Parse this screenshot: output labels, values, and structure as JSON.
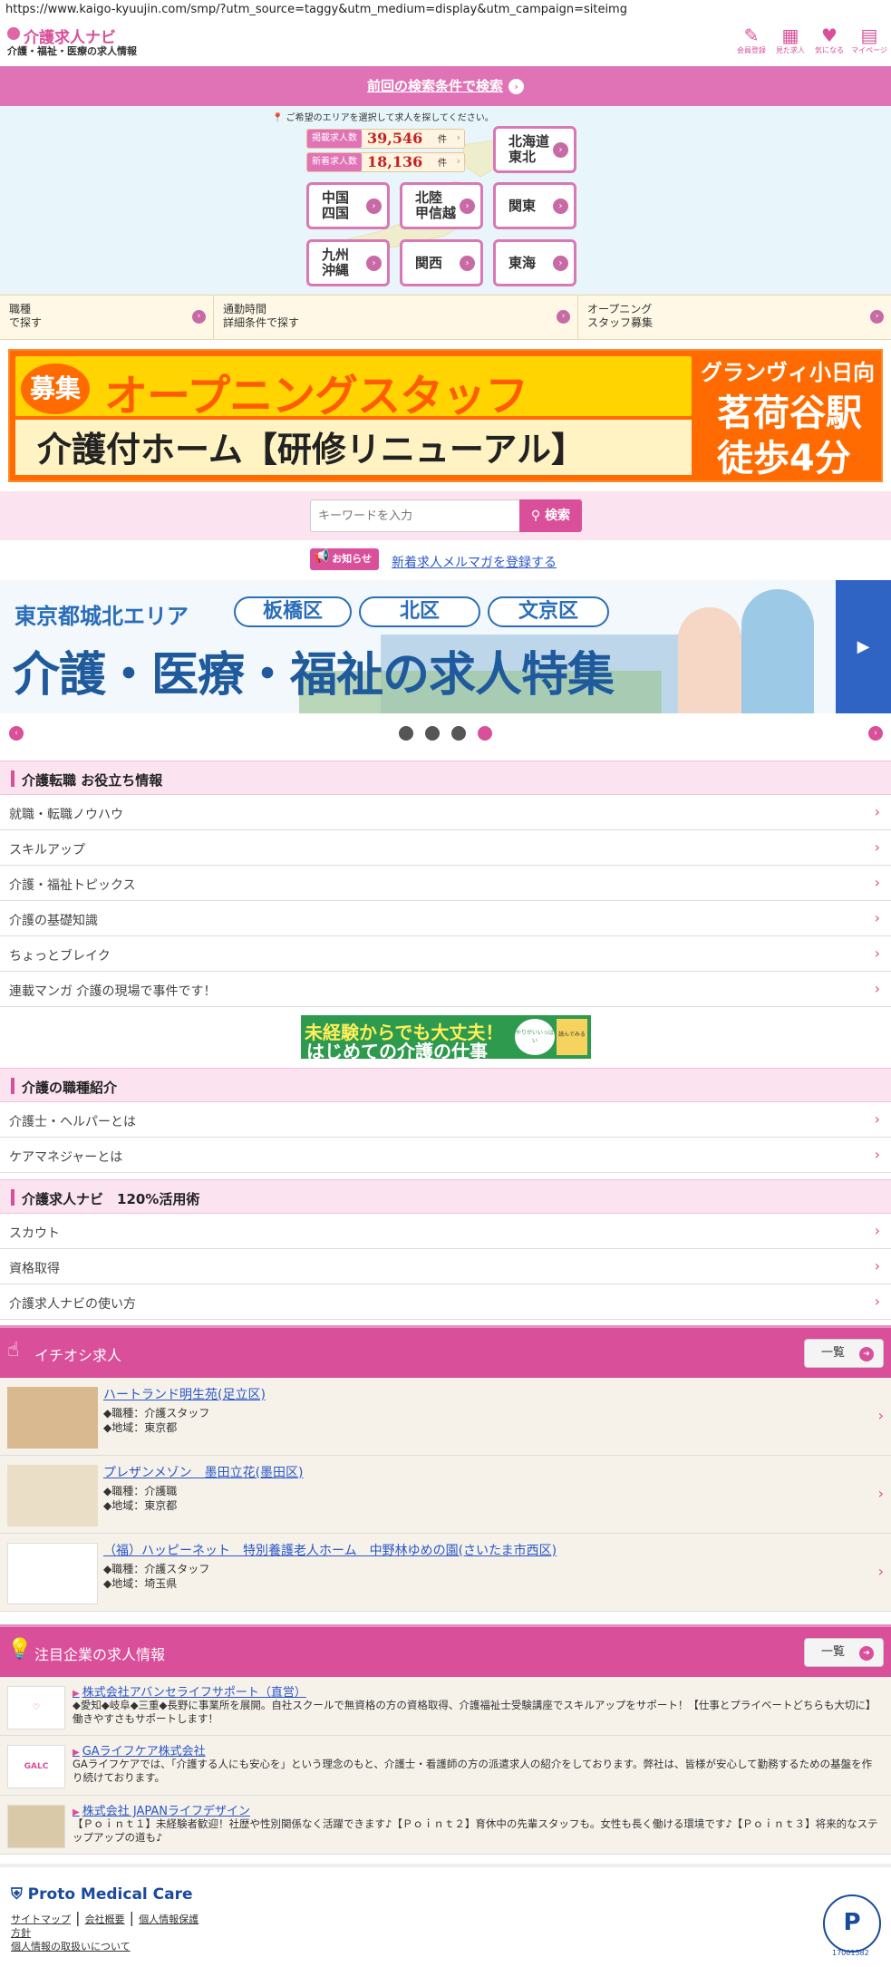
{
  "browser": {
    "url": "https://www.kaigo-kyuujin.com/smp/?utm_source=taggy&utm_medium=display&utm_campaign=siteimg"
  },
  "header": {
    "title": "介護求人ナビ",
    "subtitle": "介護・福祉・医療の求人情報",
    "icons": [
      {
        "label": "会員登録",
        "icon": "pen-icon"
      },
      {
        "label": "見た求人",
        "icon": "calendar-icon"
      },
      {
        "label": "気になる",
        "icon": "heart-icon"
      },
      {
        "label": "マイページ",
        "icon": "mypage-icon"
      }
    ]
  },
  "prev_search": {
    "label": "前回の検索条件で検索"
  },
  "area": {
    "note": "ご希望のエリアを選択して求人を探してください。",
    "counts": [
      {
        "label": "掲載求人数",
        "value": "39,546",
        "unit": "件"
      },
      {
        "label": "新着求人数",
        "value": "18,136",
        "unit": "件"
      }
    ],
    "regions": {
      "hokkaido": "北海道\n東北",
      "chugoku": "中国\n四国",
      "hokuriku": "北陸\n甲信越",
      "kanto": "関東",
      "kyushu": "九州\n沖縄",
      "kansai": "関西",
      "tokai": "東海"
    }
  },
  "categories": [
    {
      "label": "職種\nで探す"
    },
    {
      "label": "通勤時間\n詳細条件で探す"
    },
    {
      "label": "オープニング\nスタッフ募集"
    }
  ],
  "banner1": {
    "badge": "募集",
    "title": "オープニングスタッフ",
    "sub": "介護付ホーム【研修リニューアル】",
    "r1": "グランヴィ小日向",
    "r2": "茗荷谷駅",
    "r3": "徒歩4分"
  },
  "search": {
    "placeholder": "キーワードを入力",
    "button": "検索"
  },
  "news": {
    "badge": "お知らせ",
    "link": "新着求人メルマガを登録する"
  },
  "banner2": {
    "area": "東京都城北エリア",
    "wards": [
      "板橋区",
      "北区",
      "文京区"
    ],
    "main": "介護・医療・福祉の求人特集"
  },
  "sections": [
    {
      "title": "介護転職 お役立ち情報",
      "items": [
        "就職・転職ノウハウ",
        "スキルアップ",
        "介護・福祉トピックス",
        "介護の基礎知識",
        "ちょっとブレイク",
        "連載マンガ 介護の現場で事件です！"
      ]
    },
    {
      "title": "介護の職種紹介",
      "items": [
        "介護士・ヘルパーとは",
        "ケアマネジャーとは"
      ]
    },
    {
      "title": "介護求人ナビ　120%活用術",
      "items": [
        "スカウト",
        "資格取得",
        "介護求人ナビの使い方"
      ]
    }
  ],
  "banner3": {
    "t1": "未経験からでも大丈夫！",
    "t2": "はじめての介護の仕事",
    "c1": "やりがいいっぱい",
    "c2": "読んでみる"
  },
  "pickup": {
    "title": "イチオシ求人",
    "button": "一覧",
    "jobs": [
      {
        "title": "ハートランド明生苑(足立区)",
        "d1": "◆職種：介護スタッフ",
        "d2": "◆地域：東京都"
      },
      {
        "title": "プレザンメゾン　墨田立花(墨田区)",
        "d1": "◆職種：介護職",
        "d2": "◆地域：東京都"
      },
      {
        "title": "（福）ハッピーネット　特別養護老人ホーム　中野林ゆめの園(さいたま市西区)",
        "d1": "◆職種：介護スタッフ",
        "d2": "◆地域：埼玉県"
      }
    ]
  },
  "featured": {
    "title": "注目企業の求人情報",
    "button": "一覧",
    "corps": [
      {
        "title": "株式会社アバンセライフサポート（直営）",
        "desc": "◆愛知◆岐阜◆三重◆長野に事業所を展開。自社スクールで無資格の方の資格取得、介護福祉士受験講座でスキルアップをサポート！【仕事とプライベートどちらも大切に】働きやすさもサポートします！"
      },
      {
        "title": "GAライフケア株式会社",
        "desc": "GAライフケアでは、「介護する人にも安心を」という理念のもと、介護士・看護師の方の派遣求人の紹介をしております。弊社は、皆様が安心して勤務するための基盤を作り続けております。"
      },
      {
        "title": "株式会社 JAPANライフデザイン",
        "desc": "【Ｐｏｉｎｔ１】未経験者歓迎！社歴や性別関係なく活躍できます♪【Ｐｏｉｎｔ２】育休中の先輩スタッフも。女性も長く働ける環境です♪【Ｐｏｉｎｔ３】将来的なステップアップの道も♪"
      }
    ]
  },
  "footer": {
    "logo": "Proto Medical Care",
    "links": [
      "サイトマップ",
      "会社概要",
      "個人情報保護",
      "方針",
      "個人情報の取扱いについて"
    ],
    "privacy_mark": "P",
    "privacy_number": "17001582"
  }
}
